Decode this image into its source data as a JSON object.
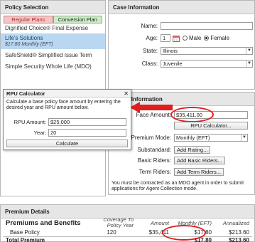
{
  "policy_selection": {
    "title": "Policy Selection",
    "tabs": [
      "Regular Plans",
      "Conversion Plan"
    ],
    "plans": [
      {
        "name": "Dignified Choice® Final Expense",
        "sub": ""
      },
      {
        "name": "Life's Solutions",
        "sub": "$17.80 Monthly (EFT)"
      },
      {
        "name": "SafeShield® Simplified Issue Term",
        "sub": ""
      },
      {
        "name": "Simple Security Whole Life (MDO)",
        "sub": ""
      }
    ]
  },
  "case_info": {
    "title": "Case Information",
    "name_label": "Name:",
    "name_value": "",
    "age_label": "Age:",
    "age_value": "1",
    "sex_options": [
      "Male",
      "Female"
    ],
    "sex_selected": "Female",
    "state_label": "State:",
    "state_value": "Illinois",
    "class_label": "Class:",
    "class_value": "Juvenile"
  },
  "policy_info": {
    "title": "Policy Information",
    "face_amount_label": "Face Amount:",
    "face_amount_value": "$35,411.00",
    "rpu_button": "RPU Calculator...",
    "premium_mode_label": "Premium Mode:",
    "premium_mode_value": "Monthly (EFT)",
    "substandard_label": "Substandard:",
    "substandard_button": "Add Rating...",
    "basic_riders_label": "Basic Riders:",
    "basic_riders_button": "Add Basic Riders...",
    "term_riders_label": "Term Riders:",
    "term_riders_button": "Add Term Riders...",
    "note": "You must be contracted as an MDO agent in order to submit applications for Agent Collection mode."
  },
  "rpu_calculator": {
    "title": "RPU Calculator",
    "description": "Calculate a base policy face amount by entering the desired year and RPU amount below.",
    "rpu_amount_label": "RPU Amount:",
    "rpu_amount_value": "$25,000",
    "year_label": "Year:",
    "year_value": "20",
    "calculate_button": "Calculate"
  },
  "premium_details": {
    "title": "Premium Details",
    "headers": [
      "Premiums and Benefits",
      "Coverage To Policy Year",
      "Amount",
      "Monthly (EFT)",
      "Annualized"
    ],
    "rows": [
      [
        "Base Policy",
        "120",
        "$35,411",
        "$17.80",
        "$213.60"
      ]
    ],
    "total": [
      "Total Premium",
      "",
      "",
      "$17.80",
      "$213.60"
    ]
  },
  "colors": {
    "highlight_ring": "#e01e1e",
    "arrow": "#e01e1e",
    "selected_plan": "#b9d7f0",
    "active_tab": "#f3c6c6",
    "other_tab": "#ccecc6"
  },
  "icons": {
    "calendar": "calendar-icon",
    "close": "close-icon",
    "dropdown": "chevron-down-icon",
    "arrow": "red-arrow-icon"
  }
}
